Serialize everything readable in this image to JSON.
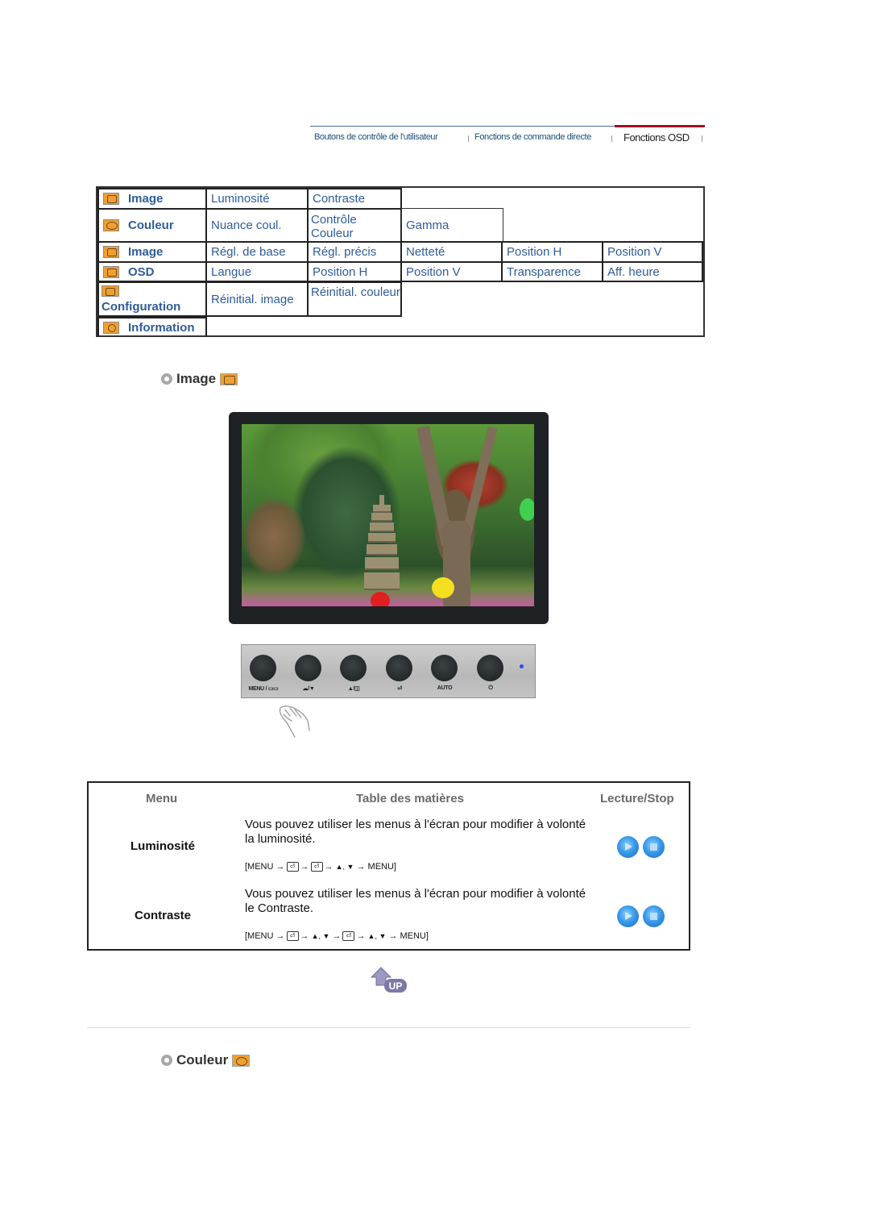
{
  "topnav": {
    "tabs": [
      {
        "label": "Boutons de contrôle de l'utilisateur",
        "active": false
      },
      {
        "label": "Fonctions de commande directe",
        "active": false
      },
      {
        "label": "Fonctions OSD",
        "active": true
      }
    ]
  },
  "osd_menu": {
    "rows": [
      {
        "category": "Image",
        "icon": "image-icon",
        "items": [
          "Luminosité",
          "Contraste"
        ]
      },
      {
        "category": "Couleur",
        "icon": "color-palette-icon",
        "items": [
          "Nuance coul.",
          "Contrôle Couleur",
          "Gamma"
        ]
      },
      {
        "category": "Image",
        "icon": "screen-adjust-icon",
        "items": [
          "Régl. de base",
          "Régl. précis",
          "Netteté",
          "Position H",
          "Position V"
        ]
      },
      {
        "category": "OSD",
        "icon": "osd-icon",
        "items": [
          "Langue",
          "Position H",
          "Position V",
          "Transparence",
          "Aff. heure"
        ]
      },
      {
        "category": "Configuration",
        "icon": "settings-sliders-icon",
        "items": [
          "Réinitial. image",
          "Réinitial. couleur"
        ]
      },
      {
        "category": "Information",
        "icon": "info-clock-icon",
        "items": []
      }
    ]
  },
  "section_image": {
    "title": "Image"
  },
  "control_panel": {
    "buttons": [
      {
        "label": "MENU / ▭▭"
      },
      {
        "label": "☁/▼"
      },
      {
        "label": "▲/◫"
      },
      {
        "label": "⏎"
      },
      {
        "label": "AUTO"
      },
      {
        "label": "⏻"
      }
    ],
    "led_color": "#2a48ff"
  },
  "desc_table": {
    "headers": {
      "menu": "Menu",
      "contents": "Table des matières",
      "play": "Lecture/Stop"
    },
    "rows": [
      {
        "name": "Luminosité",
        "text": "Vous pouvez utiliser les menus à l'écran pour modifier à volonté la luminosité.",
        "path": [
          "[MENU",
          "→",
          "⏎",
          "→",
          "⏎",
          "→",
          "▲, ▼",
          "→",
          "MENU]"
        ]
      },
      {
        "name": "Contraste",
        "text": "Vous pouvez utiliser les menus à l'écran pour modifier à volonté le Contraste.",
        "path": [
          "[MENU",
          "→",
          "⏎",
          "→",
          "▲, ▼",
          "→",
          "⏎",
          "→",
          "▲, ▼",
          "→",
          "MENU]"
        ]
      }
    ]
  },
  "up_button": {
    "label": "UP"
  },
  "section_couleur": {
    "title": "Couleur"
  },
  "colors": {
    "link_blue": "#2e5c9a",
    "nav_red": "#a01020",
    "icon_orange": "#f0a030"
  }
}
